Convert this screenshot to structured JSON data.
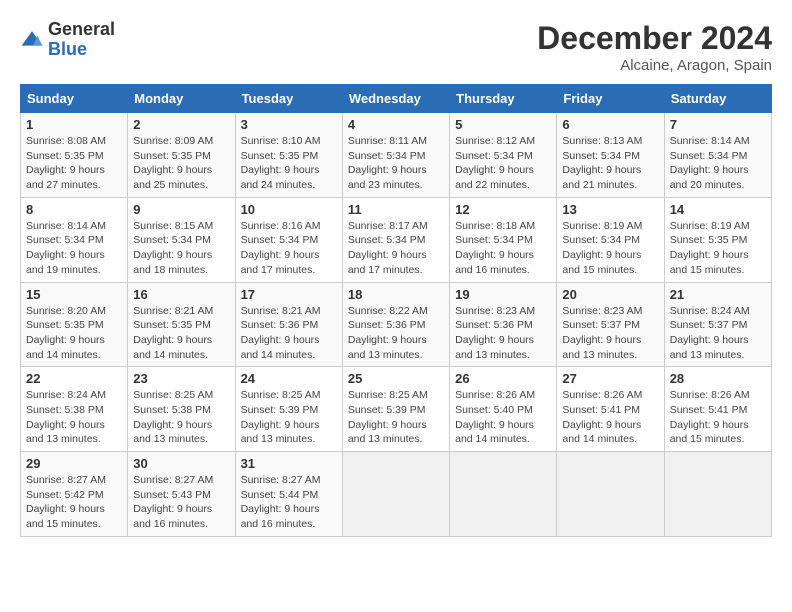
{
  "logo": {
    "general": "General",
    "blue": "Blue"
  },
  "header": {
    "month": "December 2024",
    "location": "Alcaine, Aragon, Spain"
  },
  "weekdays": [
    "Sunday",
    "Monday",
    "Tuesday",
    "Wednesday",
    "Thursday",
    "Friday",
    "Saturday"
  ],
  "weeks": [
    [
      {
        "day": "1",
        "sunrise": "8:08 AM",
        "sunset": "5:35 PM",
        "daylight": "9 hours and 27 minutes."
      },
      {
        "day": "2",
        "sunrise": "8:09 AM",
        "sunset": "5:35 PM",
        "daylight": "9 hours and 25 minutes."
      },
      {
        "day": "3",
        "sunrise": "8:10 AM",
        "sunset": "5:35 PM",
        "daylight": "9 hours and 24 minutes."
      },
      {
        "day": "4",
        "sunrise": "8:11 AM",
        "sunset": "5:34 PM",
        "daylight": "9 hours and 23 minutes."
      },
      {
        "day": "5",
        "sunrise": "8:12 AM",
        "sunset": "5:34 PM",
        "daylight": "9 hours and 22 minutes."
      },
      {
        "day": "6",
        "sunrise": "8:13 AM",
        "sunset": "5:34 PM",
        "daylight": "9 hours and 21 minutes."
      },
      {
        "day": "7",
        "sunrise": "8:14 AM",
        "sunset": "5:34 PM",
        "daylight": "9 hours and 20 minutes."
      }
    ],
    [
      {
        "day": "8",
        "sunrise": "8:14 AM",
        "sunset": "5:34 PM",
        "daylight": "9 hours and 19 minutes."
      },
      {
        "day": "9",
        "sunrise": "8:15 AM",
        "sunset": "5:34 PM",
        "daylight": "9 hours and 18 minutes."
      },
      {
        "day": "10",
        "sunrise": "8:16 AM",
        "sunset": "5:34 PM",
        "daylight": "9 hours and 17 minutes."
      },
      {
        "day": "11",
        "sunrise": "8:17 AM",
        "sunset": "5:34 PM",
        "daylight": "9 hours and 17 minutes."
      },
      {
        "day": "12",
        "sunrise": "8:18 AM",
        "sunset": "5:34 PM",
        "daylight": "9 hours and 16 minutes."
      },
      {
        "day": "13",
        "sunrise": "8:19 AM",
        "sunset": "5:34 PM",
        "daylight": "9 hours and 15 minutes."
      },
      {
        "day": "14",
        "sunrise": "8:19 AM",
        "sunset": "5:35 PM",
        "daylight": "9 hours and 15 minutes."
      }
    ],
    [
      {
        "day": "15",
        "sunrise": "8:20 AM",
        "sunset": "5:35 PM",
        "daylight": "9 hours and 14 minutes."
      },
      {
        "day": "16",
        "sunrise": "8:21 AM",
        "sunset": "5:35 PM",
        "daylight": "9 hours and 14 minutes."
      },
      {
        "day": "17",
        "sunrise": "8:21 AM",
        "sunset": "5:36 PM",
        "daylight": "9 hours and 14 minutes."
      },
      {
        "day": "18",
        "sunrise": "8:22 AM",
        "sunset": "5:36 PM",
        "daylight": "9 hours and 13 minutes."
      },
      {
        "day": "19",
        "sunrise": "8:23 AM",
        "sunset": "5:36 PM",
        "daylight": "9 hours and 13 minutes."
      },
      {
        "day": "20",
        "sunrise": "8:23 AM",
        "sunset": "5:37 PM",
        "daylight": "9 hours and 13 minutes."
      },
      {
        "day": "21",
        "sunrise": "8:24 AM",
        "sunset": "5:37 PM",
        "daylight": "9 hours and 13 minutes."
      }
    ],
    [
      {
        "day": "22",
        "sunrise": "8:24 AM",
        "sunset": "5:38 PM",
        "daylight": "9 hours and 13 minutes."
      },
      {
        "day": "23",
        "sunrise": "8:25 AM",
        "sunset": "5:38 PM",
        "daylight": "9 hours and 13 minutes."
      },
      {
        "day": "24",
        "sunrise": "8:25 AM",
        "sunset": "5:39 PM",
        "daylight": "9 hours and 13 minutes."
      },
      {
        "day": "25",
        "sunrise": "8:25 AM",
        "sunset": "5:39 PM",
        "daylight": "9 hours and 13 minutes."
      },
      {
        "day": "26",
        "sunrise": "8:26 AM",
        "sunset": "5:40 PM",
        "daylight": "9 hours and 14 minutes."
      },
      {
        "day": "27",
        "sunrise": "8:26 AM",
        "sunset": "5:41 PM",
        "daylight": "9 hours and 14 minutes."
      },
      {
        "day": "28",
        "sunrise": "8:26 AM",
        "sunset": "5:41 PM",
        "daylight": "9 hours and 15 minutes."
      }
    ],
    [
      {
        "day": "29",
        "sunrise": "8:27 AM",
        "sunset": "5:42 PM",
        "daylight": "9 hours and 15 minutes."
      },
      {
        "day": "30",
        "sunrise": "8:27 AM",
        "sunset": "5:43 PM",
        "daylight": "9 hours and 16 minutes."
      },
      {
        "day": "31",
        "sunrise": "8:27 AM",
        "sunset": "5:44 PM",
        "daylight": "9 hours and 16 minutes."
      },
      null,
      null,
      null,
      null
    ]
  ],
  "labels": {
    "sunrise": "Sunrise:",
    "sunset": "Sunset:",
    "daylight": "Daylight:"
  }
}
